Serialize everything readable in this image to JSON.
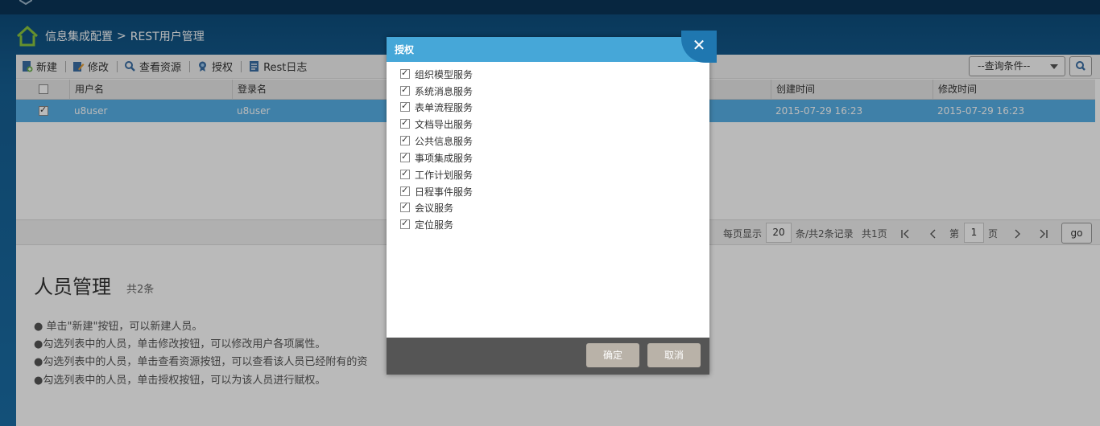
{
  "breadcrumb": {
    "section": "信息集成配置",
    "separator": ">",
    "page": "REST用户管理"
  },
  "toolbar": {
    "new_label": "新建",
    "edit_label": "修改",
    "view_resource_label": "查看资源",
    "authorize_label": "授权",
    "rest_log_label": "Rest日志",
    "query_placeholder": "--查询条件--"
  },
  "grid": {
    "columns": [
      "用户名",
      "登录名",
      "创建时间",
      "修改时间"
    ],
    "rows": [
      {
        "checked": true,
        "username": "u8user",
        "login": "u8user",
        "created": "2015-07-29 16:23",
        "modified": "2015-07-29 16:23"
      }
    ]
  },
  "pager": {
    "per_page_label": "每页显示",
    "per_page": "20",
    "records_label": "条/共2条记录",
    "pages_label": "共1页",
    "page_prefix": "第",
    "page": "1",
    "page_suffix": "页",
    "go_label": "go"
  },
  "help": {
    "title": "人员管理",
    "count": "共2条",
    "lines": [
      "● 单击\"新建\"按钮，可以新建人员。",
      "●勾选列表中的人员，单击修改按钮，可以修改用户各项属性。",
      "●勾选列表中的人员，单击查看资源按钮，可以查看该人员已经附有的资",
      "●勾选列表中的人员，单击授权按钮，可以为该人员进行赋权。"
    ]
  },
  "dialog": {
    "title": "授权",
    "items": [
      "组织模型服务",
      "系统消息服务",
      "表单流程服务",
      "文档导出服务",
      "公共信息服务",
      "事项集成服务",
      "工作计划服务",
      "日程事件服务",
      "会议服务",
      "定位服务"
    ],
    "ok_label": "确定",
    "cancel_label": "取消"
  },
  "colors": {
    "dialog_header": "#46a7d8",
    "selected_row": "#57b0e6",
    "footer": "#555555",
    "button": "#b9b2a8"
  }
}
